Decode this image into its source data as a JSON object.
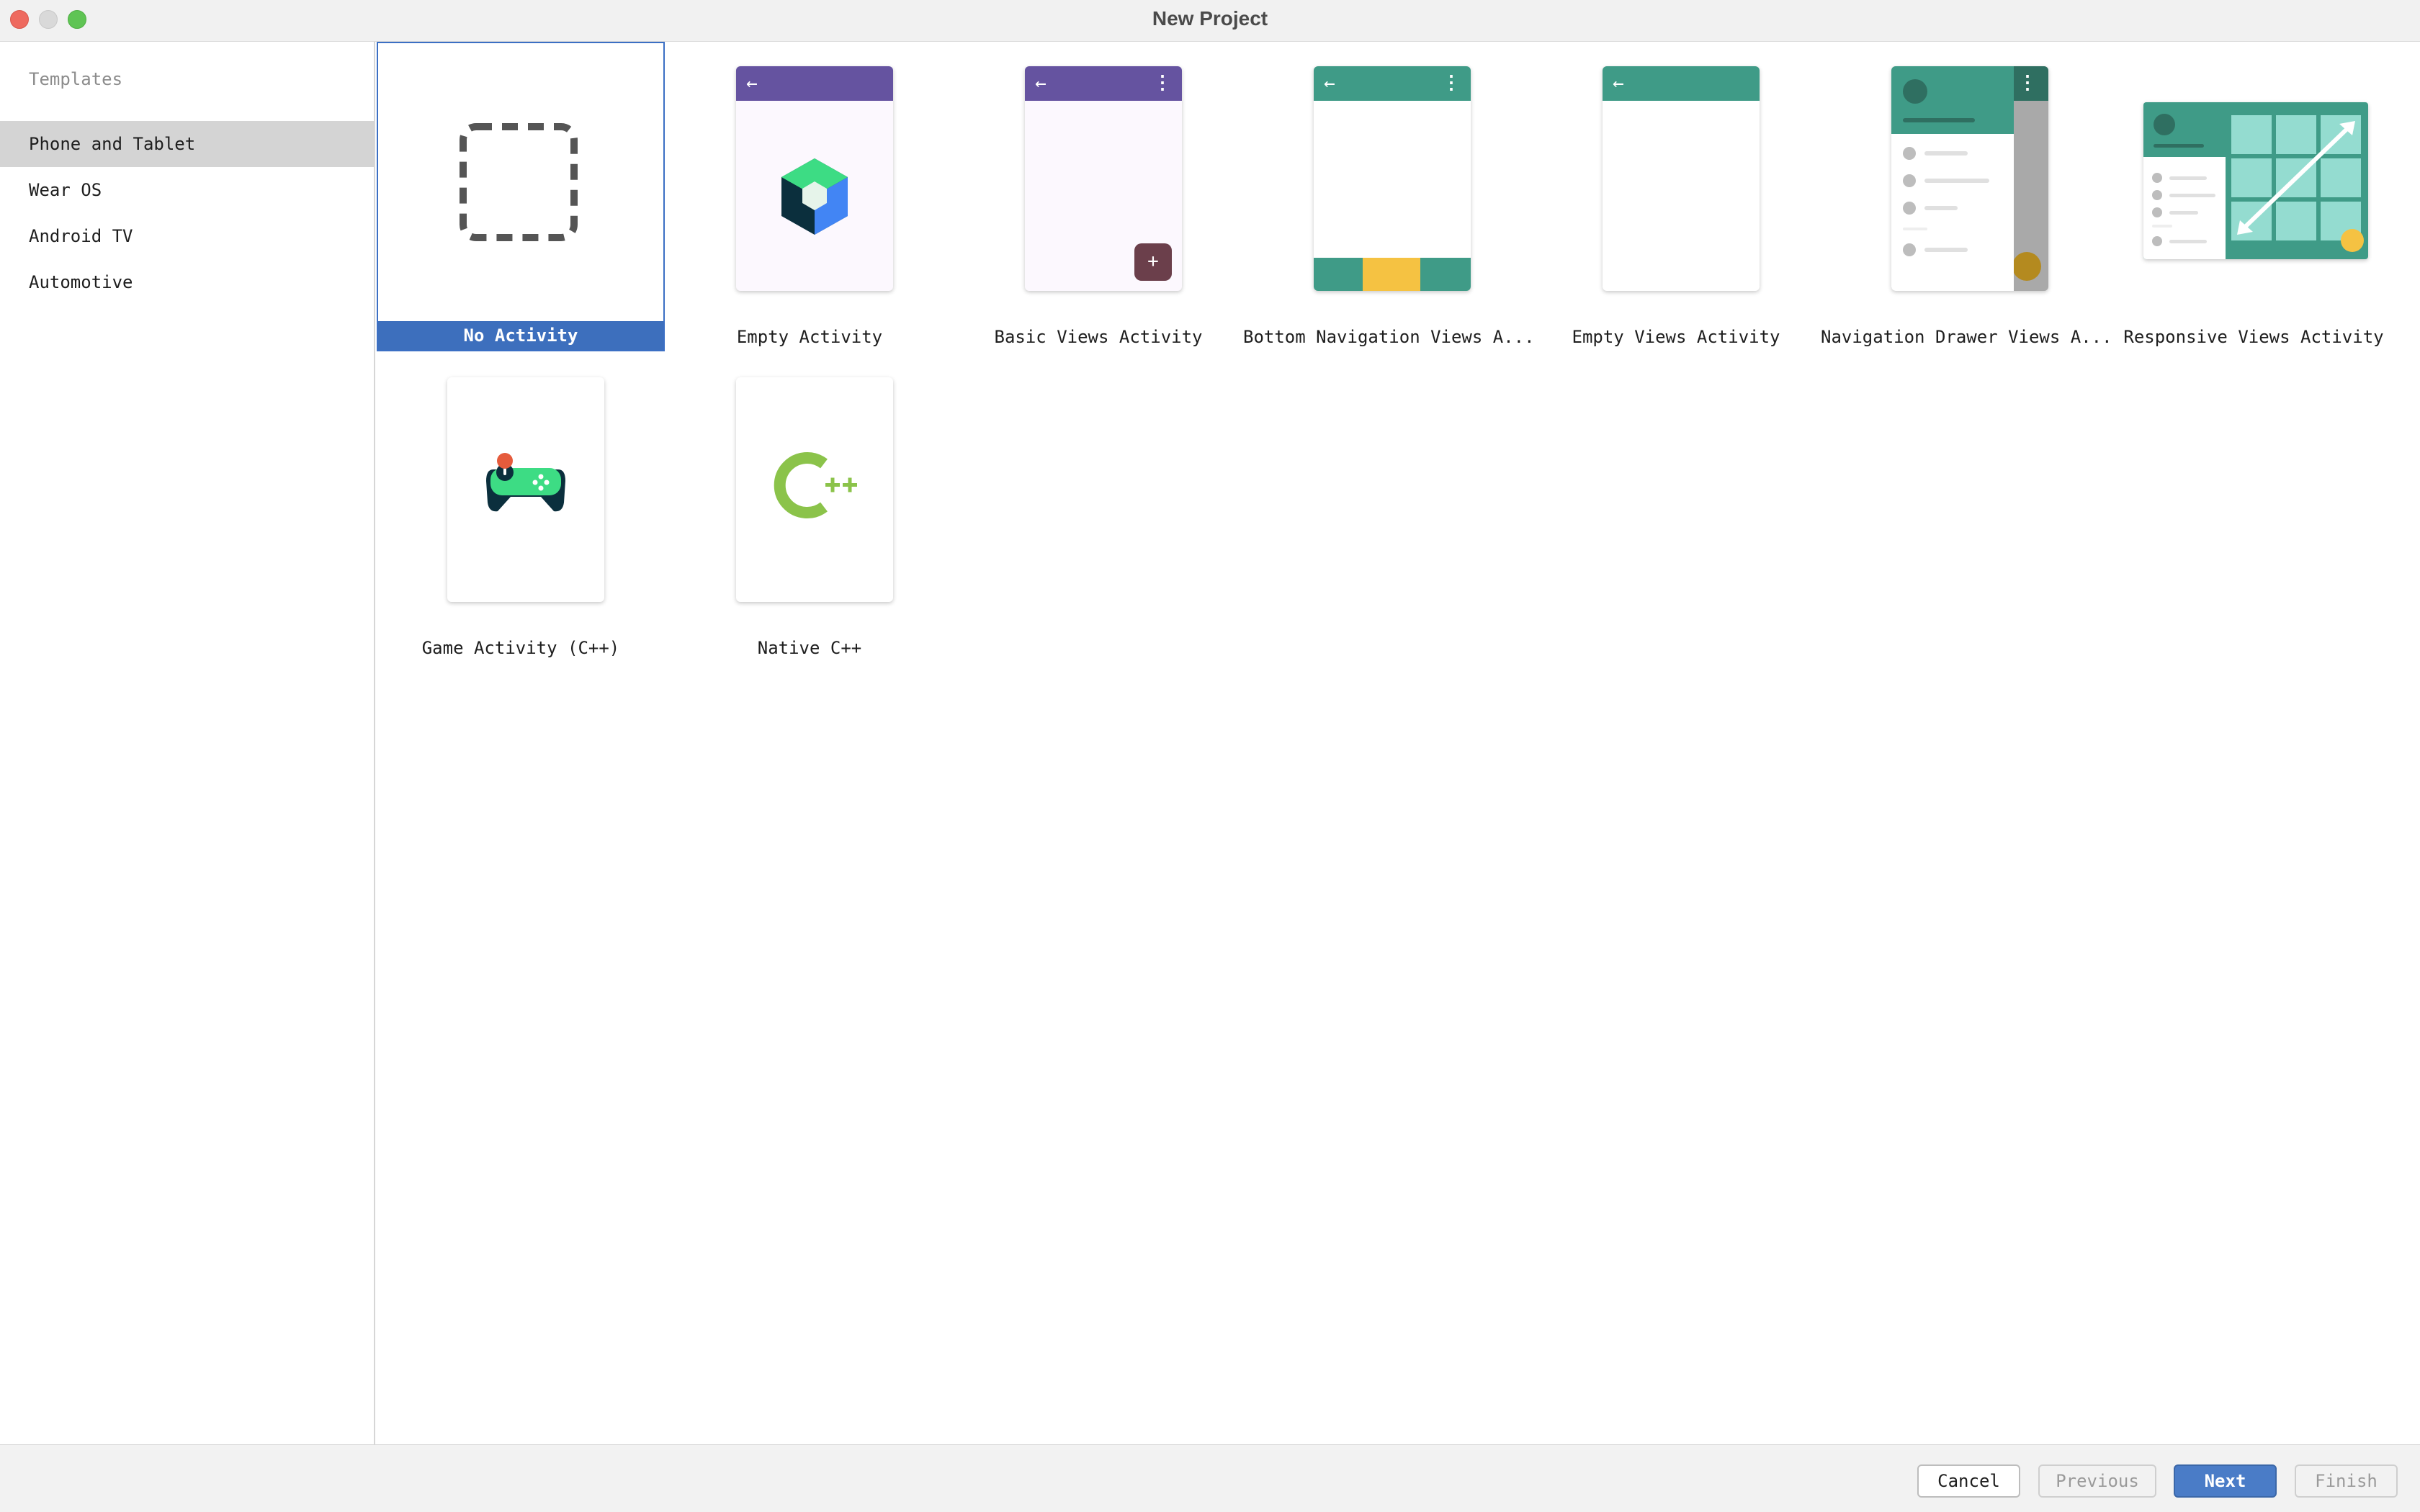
{
  "window": {
    "title": "New Project"
  },
  "sidebar": {
    "header": "Templates",
    "items": [
      {
        "label": "Phone and Tablet",
        "selected": true
      },
      {
        "label": "Wear OS",
        "selected": false
      },
      {
        "label": "Android TV",
        "selected": false
      },
      {
        "label": "Automotive",
        "selected": false
      }
    ]
  },
  "templates": [
    {
      "label": "No Activity",
      "selected": true,
      "icon": "dashed-square-icon"
    },
    {
      "label": "Empty Activity",
      "icon": "compose-hexagon-icon"
    },
    {
      "label": "Basic Views Activity",
      "icon": "basic-views-preview"
    },
    {
      "label": "Bottom Navigation Views A...",
      "icon": "bottom-navigation-preview"
    },
    {
      "label": "Empty Views Activity",
      "icon": "empty-views-preview"
    },
    {
      "label": "Navigation Drawer Views A...",
      "icon": "navigation-drawer-preview"
    },
    {
      "label": "Responsive Views Activity",
      "icon": "responsive-views-preview"
    },
    {
      "label": "Game Activity (C++)",
      "icon": "gamepad-icon"
    },
    {
      "label": "Native C++",
      "icon": "cpp-logo-icon"
    }
  ],
  "footer": {
    "cancel": "Cancel",
    "previous": "Previous",
    "next": "Next",
    "finish": "Finish"
  },
  "colors": {
    "accent": "#3d6fbd",
    "purple_bar": "#6553a0",
    "teal_bar": "#3f9b87",
    "yellow": "#f5c242",
    "fab_maroon": "#6b3f4b"
  }
}
